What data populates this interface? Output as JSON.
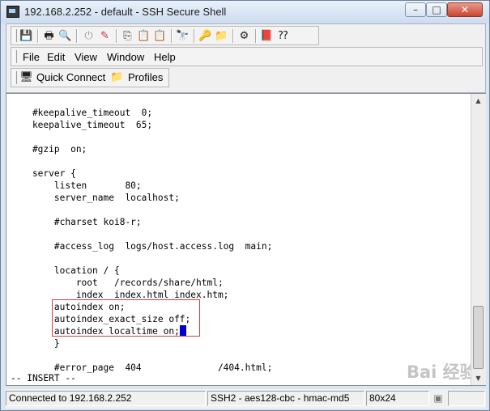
{
  "window": {
    "title": "192.168.2.252 - default - SSH Secure Shell",
    "minimize": "–",
    "maximize": "□",
    "close": "✕"
  },
  "toolbar": {
    "icons": [
      "save-icon",
      "print-icon",
      "print-preview-icon",
      "disconnect-icon",
      "settings-icon",
      "copy-icon",
      "paste-icon",
      "paste-special-icon",
      "find-icon",
      "key-icon",
      "file-transfer-icon",
      "tools-icon",
      "help-book-icon",
      "context-help-icon"
    ]
  },
  "menu": {
    "file": "File",
    "edit": "Edit",
    "view": "View",
    "window": "Window",
    "help": "Help"
  },
  "quickbar": {
    "quick_connect": "Quick Connect",
    "profiles": "Profiles"
  },
  "terminal": {
    "lines": [
      "",
      "    #keepalive_timeout  0;",
      "    keepalive_timeout  65;",
      "",
      "    #gzip  on;",
      "",
      "    server {",
      "        listen       80;",
      "        server_name  localhost;",
      "",
      "        #charset koi8-r;",
      "",
      "        #access_log  logs/host.access.log  main;",
      "",
      "        location / {",
      "            root   /records/share/html;",
      "            index  index.html index.htm;",
      "        autoindex on;",
      "        autoindex_exact_size off;",
      "        autoindex_localtime on;",
      "        }",
      "",
      "        #error_page  404              /404.html;",
      "-- INSERT --"
    ],
    "watermark": "Bai 经验"
  },
  "status": {
    "connection": "Connected to 192.168.2.252",
    "cipher": "SSH2 - aes128-cbc - hmac-md5",
    "size": "80x24"
  }
}
